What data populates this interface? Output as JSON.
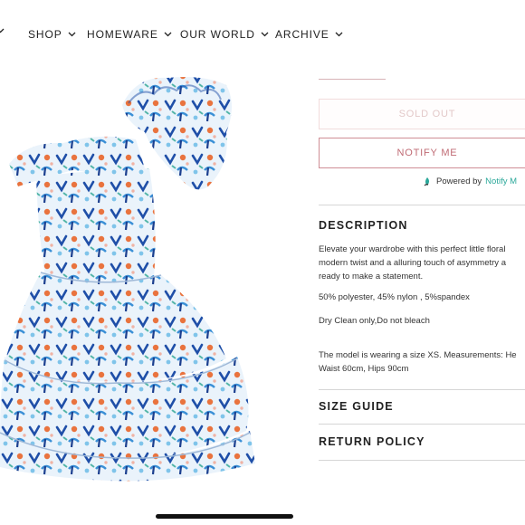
{
  "nav": {
    "items": [
      {
        "label": ""
      },
      {
        "label": "SHOP"
      },
      {
        "label": "HOMEWARE"
      },
      {
        "label": "OUR WORLD"
      },
      {
        "label": "ARCHIVE"
      }
    ]
  },
  "product": {
    "sold_out_label": "SOLD OUT",
    "notify_label": "NOTIFY ME",
    "powered_by": "Powered by",
    "powered_brand": "Notify M"
  },
  "description": {
    "heading": "DESCRIPTION",
    "lines": [
      "Elevate your wardrobe with this perfect little floral",
      "modern twist and a alluring touch of asymmetry a",
      "ready to make a statement."
    ],
    "composition": "50% polyester,  45% nylon ,  5%spandex",
    "care": "Dry Clean only,Do not bleach",
    "model_lines": [
      "The model is wearing a size XS. Measurements: He",
      "Waist 60cm, Hips 90cm"
    ]
  },
  "sections": {
    "size_guide": "SIZE GUIDE",
    "return_policy": "RETURN POLICY"
  },
  "colors": {
    "accent": "#c06b74",
    "brand": "#2ba89a",
    "divider": "#d6d6d6"
  }
}
